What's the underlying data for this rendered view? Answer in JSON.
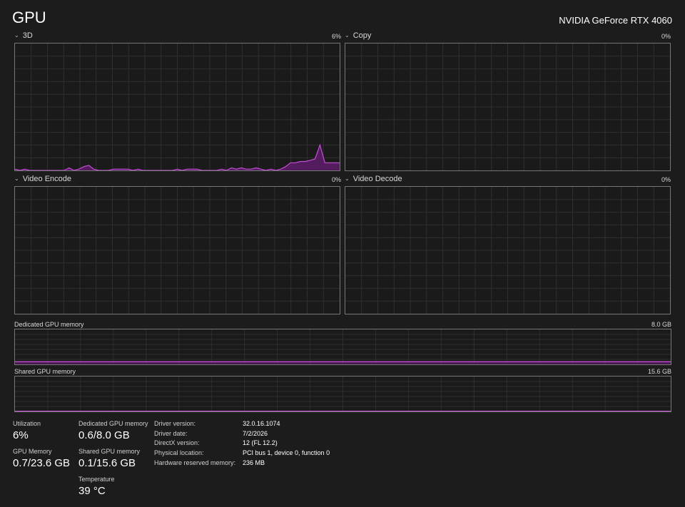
{
  "header": {
    "title": "GPU",
    "gpu_name": "NVIDIA GeForce RTX 4060"
  },
  "graphs": {
    "threed": {
      "label": "3D",
      "value": "6%",
      "samples": [
        1,
        0,
        1,
        0,
        0,
        0,
        0,
        0,
        0,
        0,
        0,
        2,
        0,
        1,
        3,
        4,
        1,
        0,
        0,
        0,
        1,
        1,
        1,
        1,
        0,
        1,
        0,
        0,
        0,
        0,
        0,
        0,
        0,
        1,
        0,
        1,
        1,
        1,
        0,
        0,
        0,
        0,
        1,
        0,
        2,
        1,
        2,
        1,
        1,
        2,
        1,
        0,
        1,
        0,
        1,
        3,
        6,
        6,
        7,
        7,
        8,
        9,
        20,
        6,
        6,
        6,
        6
      ]
    },
    "copy": {
      "label": "Copy",
      "value": "0%"
    },
    "video_encode": {
      "label": "Video Encode",
      "value": "0%"
    },
    "video_decode": {
      "label": "Video Decode",
      "value": "0%"
    },
    "dedicated_memory": {
      "label": "Dedicated GPU memory",
      "value": "8.0 GB",
      "fraction": 0.075
    },
    "shared_memory": {
      "label": "Shared GPU memory",
      "value": "15.6 GB",
      "fraction": 0.006
    }
  },
  "stats": {
    "utilization": {
      "label": "Utilization",
      "value": "6%"
    },
    "gpu_memory": {
      "label": "GPU Memory",
      "value": "0.7/23.6 GB"
    },
    "dedicated": {
      "label": "Dedicated GPU memory",
      "value": "0.6/8.0 GB"
    },
    "shared": {
      "label": "Shared GPU memory",
      "value": "0.1/15.6 GB"
    },
    "temperature": {
      "label": "Temperature",
      "value": "39 °C"
    }
  },
  "info": {
    "driver_version": {
      "key": "Driver version:",
      "value": "32.0.16.1074"
    },
    "driver_date": {
      "key": "Driver date:",
      "value": "7/2/2026"
    },
    "directx": {
      "key": "DirectX version:",
      "value": "12 (FL 12.2)"
    },
    "physical_location": {
      "key": "Physical location:",
      "value": "PCI bus 1, device 0, function 0"
    },
    "reserved_memory": {
      "key": "Hardware reserved memory:",
      "value": "236 MB"
    }
  },
  "colors": {
    "accent": "#c44fd6",
    "accent_fill": "#5a1d66",
    "grid": "#2f2f2f",
    "border": "#767676"
  }
}
